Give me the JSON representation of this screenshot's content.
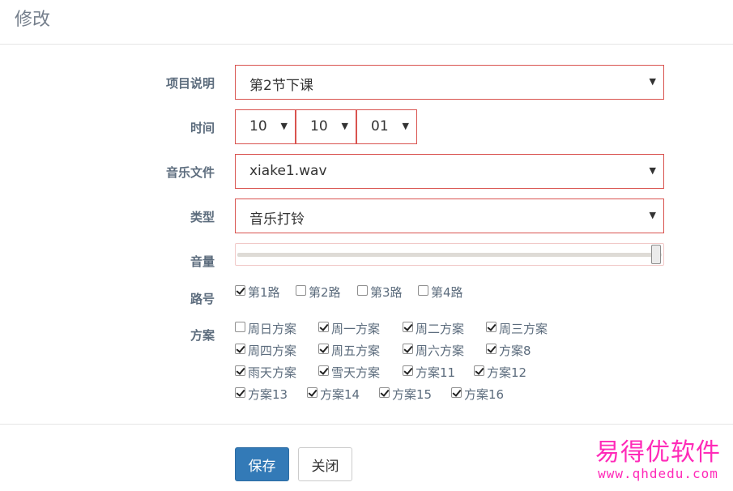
{
  "header": {
    "title": "修改"
  },
  "form": {
    "project_label": "项目说明",
    "project_value": "第2节下课",
    "time_label": "时间",
    "time_hour": "10",
    "time_minute": "10",
    "time_second": "01",
    "music_label": "音乐文件",
    "music_value": "xiake1.wav",
    "type_label": "类型",
    "type_value": "音乐打铃",
    "volume_label": "音量",
    "volume_value": 1.0,
    "route_label": "路号",
    "routes": [
      {
        "label": "第1路",
        "checked": true
      },
      {
        "label": "第2路",
        "checked": false
      },
      {
        "label": "第3路",
        "checked": false
      },
      {
        "label": "第4路",
        "checked": false
      }
    ],
    "plan_label": "方案",
    "plans": [
      {
        "label": "周日方案",
        "checked": false
      },
      {
        "label": "周一方案",
        "checked": true
      },
      {
        "label": "周二方案",
        "checked": true
      },
      {
        "label": "周三方案",
        "checked": true
      },
      {
        "label": "周四方案",
        "checked": true
      },
      {
        "label": "周五方案",
        "checked": true
      },
      {
        "label": "周六方案",
        "checked": true
      },
      {
        "label": "方案8",
        "checked": true
      },
      {
        "label": "雨天方案",
        "checked": true
      },
      {
        "label": "雪天方案",
        "checked": true
      },
      {
        "label": "方案11",
        "checked": true
      },
      {
        "label": "方案12",
        "checked": true
      },
      {
        "label": "方案13",
        "checked": true
      },
      {
        "label": "方案14",
        "checked": true
      },
      {
        "label": "方案15",
        "checked": true
      },
      {
        "label": "方案16",
        "checked": true
      }
    ]
  },
  "footer": {
    "save_label": "保存",
    "close_label": "关闭"
  },
  "watermark": {
    "title": "易得优软件",
    "url": "www.qhdedu.com"
  },
  "colors": {
    "primary": "#337ab7",
    "error_border": "#d9534f",
    "label_text": "#5c6c7d",
    "watermark": "#ff2ab8"
  }
}
